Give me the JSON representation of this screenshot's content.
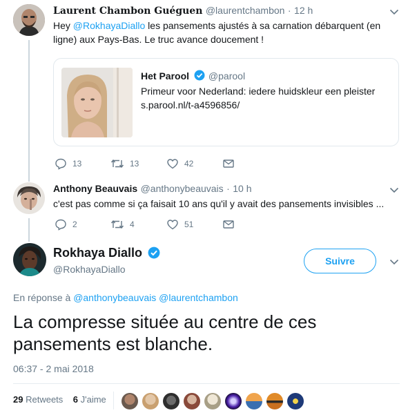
{
  "tweet1": {
    "name": "Laurent Chambon Guéguen",
    "handle": "@laurentchambon",
    "separator": "·",
    "time": "12 h",
    "text_prefix": "Hey ",
    "mention": "@RokhayaDiallo",
    "text_rest": " les pansements ajustés à sa carnation débarquent (en ligne) aux Pays-Bas. Le truc avance doucement !",
    "card": {
      "name": "Het Parool",
      "handle": "@parool",
      "text": "Primeur voor Nederland: iedere huidskleur een pleister",
      "link": "s.parool.nl/t-a4596856/"
    },
    "replies": "13",
    "retweets": "13",
    "likes": "42"
  },
  "tweet2": {
    "name": "Anthony Beauvais",
    "handle": "@anthonybeauvais",
    "separator": "·",
    "time": "10 h",
    "text": "c'est pas comme si ça faisait 10 ans qu'il y avait des pansements invisibles ...",
    "replies": "2",
    "retweets": "4",
    "likes": "51"
  },
  "main": {
    "name": "Rokhaya Diallo",
    "handle": "@RokhayaDiallo",
    "follow_label": "Suivre",
    "reply_prefix": "En réponse à",
    "reply_to_1": "@anthonybeauvais",
    "reply_to_2": "@laurentchambon",
    "text": "La compresse située au centre de ces pansements est blanche.",
    "timestamp": "06:37 - 2 mai 2018",
    "retweets_count": "29",
    "retweets_label": "Retweets",
    "likes_count": "6",
    "likes_label": "J'aime"
  },
  "colors": {
    "accent": "#1da1f2",
    "muted": "#657786",
    "text": "#14171a",
    "border": "#e1e8ed"
  },
  "icons": [
    "chevron-down-icon",
    "reply-icon",
    "retweet-icon",
    "like-icon",
    "message-icon",
    "verified-badge-icon"
  ]
}
